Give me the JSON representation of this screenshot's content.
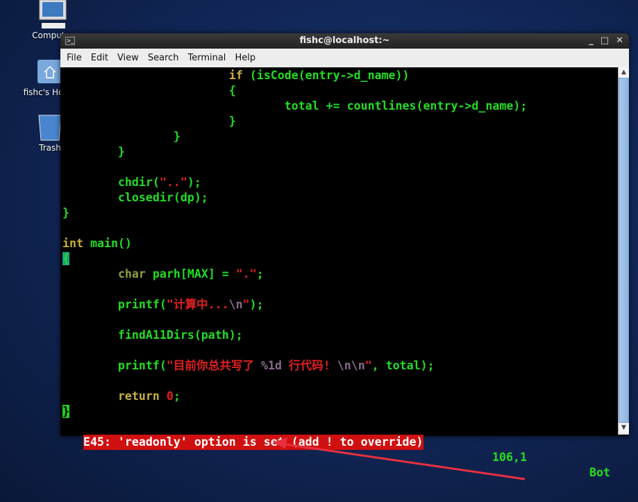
{
  "desktop": {
    "icons": [
      {
        "label": "Computer",
        "icon": "computer-icon"
      },
      {
        "label": "fishc's Home",
        "icon": "home-folder-icon"
      },
      {
        "label": "Trash",
        "icon": "trash-icon"
      }
    ]
  },
  "window": {
    "title": "fishc@localhost:~",
    "buttons": {
      "minimize": "_",
      "maximize": "□",
      "close": "✕"
    }
  },
  "menu": [
    "File",
    "Edit",
    "View",
    "Search",
    "Terminal",
    "Help"
  ],
  "editor": {
    "lines": [
      [
        [
          "                        ",
          ""
        ],
        [
          "if",
          "k"
        ],
        [
          " (isCode(entry->d_name))",
          ""
        ]
      ],
      [
        [
          "                        {",
          ""
        ]
      ],
      [
        [
          "                                total += countlines(entry->d_name);",
          ""
        ]
      ],
      [
        [
          "                        }",
          ""
        ]
      ],
      [
        [
          "                }",
          ""
        ]
      ],
      [
        [
          "        }",
          ""
        ]
      ],
      [],
      [
        [
          "        chdir(",
          ""
        ],
        [
          "\"..\"",
          "s"
        ],
        [
          ");",
          ""
        ]
      ],
      [
        [
          "        closedir(dp);",
          ""
        ]
      ],
      [
        [
          "}",
          ""
        ]
      ],
      [],
      [
        [
          "int",
          "k"
        ],
        [
          " main()",
          ""
        ]
      ],
      [
        [
          "{",
          "cur"
        ]
      ],
      [
        [
          "        ",
          ""
        ],
        [
          "char",
          "t"
        ],
        [
          " parh[MAX] = ",
          ""
        ],
        [
          "\".\"",
          "s"
        ],
        [
          ";",
          ""
        ]
      ],
      [],
      [
        [
          "        printf(",
          ""
        ],
        [
          "\"计算中...",
          "s"
        ],
        [
          "\\n",
          "e"
        ],
        [
          "\"",
          "s"
        ],
        [
          ");",
          ""
        ]
      ],
      [],
      [
        [
          "        findA11Dirs(path);",
          ""
        ]
      ],
      [],
      [
        [
          "        printf(",
          ""
        ],
        [
          "\"目前你总共写了 ",
          "s"
        ],
        [
          "%1d",
          "e"
        ],
        [
          " 行代码! ",
          "s"
        ],
        [
          "\\n\\n",
          "e"
        ],
        [
          "\"",
          "s"
        ],
        [
          ", total);",
          ""
        ]
      ],
      [],
      [
        [
          "        ",
          ""
        ],
        [
          "return",
          "k"
        ],
        [
          " ",
          ""
        ],
        [
          "0",
          "s"
        ],
        [
          ";",
          ""
        ]
      ],
      [
        [
          "}",
          "cur2"
        ]
      ]
    ],
    "status": {
      "message": "E45: 'readonly' option is set (add ! to override)",
      "position": "106,1",
      "scroll": "Bot"
    }
  },
  "colors": {
    "error_bg": "#d01010",
    "text": "#22dd22",
    "annotation_arrow": "#e83040"
  }
}
